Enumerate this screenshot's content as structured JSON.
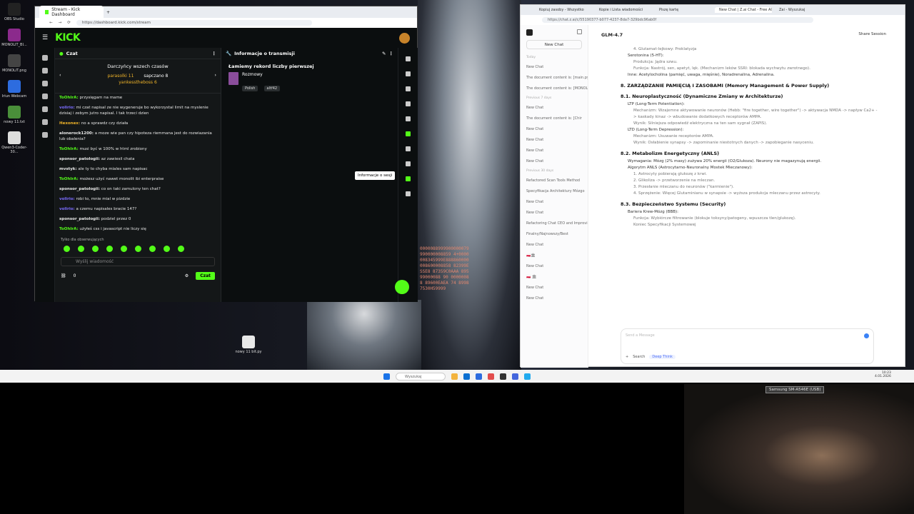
{
  "desktop": {
    "icons": [
      {
        "label": "OBS Studio",
        "icon": "obs-icon",
        "color": "#222222"
      },
      {
        "label": "MONOLIT_BI...",
        "icon": "winrar-icon",
        "color": "#8b2a8c"
      },
      {
        "label": "MONOLIT.png",
        "icon": "image-icon",
        "color": "#444444"
      },
      {
        "label": "Iriun Webcam",
        "icon": "webcam-icon",
        "color": "#2d6cdf"
      },
      {
        "label": "nowy 11.txt",
        "icon": "text-file-icon",
        "color": "#4a8f3a"
      },
      {
        "label": "Qwen3-Coder-30...",
        "icon": "document-icon",
        "color": "#dddddd"
      }
    ],
    "file_icon_label": "nowy 11 bit.py"
  },
  "kick_browser": {
    "tab_title": "Stream - Kick Dashboard",
    "url": "https://dashboard.kick.com/stream",
    "logo": "KICK",
    "chat": {
      "title": "Czat",
      "gifters_title": "Darczyńcy wszech czasów",
      "gifters": [
        {
          "name": "parasolki",
          "count": "11"
        },
        {
          "name": "sapczano",
          "count": "8"
        },
        {
          "name": "yankesstheboss",
          "count": "6"
        }
      ],
      "messages": [
        {
          "user": "ToOhIrA:",
          "text": "przysięgam na mame",
          "color": "#53fc18"
        },
        {
          "user": "volirio:",
          "text": "mi czat napisal ze nie wygeneruje bo wykorzystal limit na myslenie dzisiaj i zebym jutro napisal. I tak trzeci dzien",
          "color": "#7b6cff"
        },
        {
          "user": "Hexonex:",
          "text": "no a sprawdz czy działa",
          "color": "#f0b429"
        },
        {
          "user": "alonerock1200:",
          "text": "a moze wie pan czy hipoteza riemmana jest do rozwiazania lub obalenia?",
          "color": "#e8e8e8"
        },
        {
          "user": "ToOhIrA:",
          "text": "musi być w 100% w html zrobiony",
          "color": "#53fc18"
        },
        {
          "user": "sponsor_patologii:",
          "text": "az zawiesil chata",
          "color": "#e8e8e8"
        },
        {
          "user": "mvstyk:",
          "text": "ale ty to chyba miales sam napisac",
          "color": "#e8e8e8"
        },
        {
          "user": "ToOhIrA:",
          "text": "możesz użyć nawet monolit ibi enterpraise",
          "color": "#53fc18"
        },
        {
          "user": "sponsor_patologii:",
          "text": "co on taki zamulony ten chat?",
          "color": "#e8e8e8"
        },
        {
          "user": "volirio:",
          "text": "robi to, mnie mial w pizdzie",
          "color": "#7b6cff"
        },
        {
          "user": "volirio:",
          "text": "a czemu napisales bracie 147?",
          "color": "#7b6cff"
        },
        {
          "user": "sponsor_patologii:",
          "text": "podziel przez 0",
          "color": "#e8e8e8"
        },
        {
          "user": "ToOhIrA:",
          "text": "użyłeś css i javascript nie liczy się",
          "color": "#53fc18"
        }
      ],
      "followers_only": "Tylko dla obserwujących",
      "input_placeholder": "Wyślij wiadomość",
      "viewer_count": "0",
      "send_label": "Czat"
    },
    "stream_info": {
      "header": "Informacje o transmisji",
      "title": "Łamiemy rekord liczby pierwszej",
      "category": "Rozmowy",
      "tags": [
        "Polish",
        "altf42"
      ],
      "tooltip": "Informacje o sesji"
    }
  },
  "matrix_text": "0000088999900000079990000008859 4+0000008345999E888860000008600008858 82399ESSE8 87359C0AAA 89599000088 90 00000088 89600EAEA 74 8998 7530H59999",
  "zai_browser": {
    "tabs": [
      "Kopiuj zasoby - Wszystko",
      "Kopie i Lista wiadomości",
      "Piszę kartę",
      "New Chat | Z.ai Chat - Free AI po",
      "Zai - Wyszukaj"
    ],
    "url": "https://chat.z.ai/c/55190377-b077-4237-8da7-329bdc96ab0f",
    "sidebar": {
      "new_chat": "New Chat",
      "groups": [
        "Today",
        "Previous 7 days",
        "Previous 30 days"
      ],
      "items": [
        "New Chat",
        "The document content is: [main.py:",
        "The document content is: [MONOLI",
        "New Chat",
        "The document content is: [Chir",
        "New Chat",
        "New Chat",
        "New Chat",
        "New Chat",
        "Refactored Scan Tools Method",
        "Specyfikacja Architektury Mózgo",
        "New Chat",
        "New Chat",
        "Refactoring Chat CEO and Improving",
        "Finalny/Najnowszy/Best",
        "New Chat",
        "🇵🇱🏛",
        "New Chat",
        "🇵🇱 🏛",
        "New Chat",
        "New Chat"
      ]
    },
    "main": {
      "model": "GLM-4.7",
      "share": "Share Session",
      "content": [
        {
          "type": "sub",
          "text": "4. Glutamat-lejkowy: Proklatyzja"
        },
        {
          "type": "li",
          "text": "Serotonina (5-HT):"
        },
        {
          "type": "sub",
          "text": "Produkcja: Jądra szwu."
        },
        {
          "type": "sub",
          "text": "Funkcja: Nastrój, sen, apetyt, lęk. (Mechanizm leków SSRI: blokada wychwytu zwrotnego)."
        },
        {
          "type": "li",
          "text": "Inne: Acetylocholina (pamięć, uwaga, mięśnie), Noradrenalina, Adrenalina."
        },
        {
          "type": "h",
          "text": "8. ZARZĄDZANIE PAMIĘCIĄ I ZASOBAMI (Memory Management & Power Supply)"
        },
        {
          "type": "h",
          "text": "8.1. Neuroplastyczność (Dynamiczne Zmiany w Architekturze)"
        },
        {
          "type": "li",
          "text": "LTP (Long-Term Potentiation):"
        },
        {
          "type": "sub",
          "text": "Mechanizm: Wzajemne aktywowanie neuronów (Hebb: \"fire together, wire together\") -> aktywacja NMDA -> napływ Ca2+ -> kaskady kinaz -> wbudowanie dodatkowych receptorów AMPA."
        },
        {
          "type": "sub",
          "text": "Wynik: Silniejsza odpowiedź elektryczna na ten sam sygnał (ZAPIS)."
        },
        {
          "type": "li",
          "text": "LTD (Long-Term Depression):"
        },
        {
          "type": "sub",
          "text": "Mechanizm: Usuwanie receptorów AMPA."
        },
        {
          "type": "sub",
          "text": "Wynik: Osłabienie synapsy -> zapominanie niestotnych danych -> zapobieganie nasyceniu."
        },
        {
          "type": "h",
          "text": "8.2. Metabolizm Energetyczny (ANLS)"
        },
        {
          "type": "li",
          "text": "Wymagania: Mózg (2% masy) zużywa 20% energii (O2/Glukoza). Neurony nie magazynują energii."
        },
        {
          "type": "li",
          "text": "Algorytm ANLS (Astrocytarno-Neuronalny Mostek Mleczanowy):"
        },
        {
          "type": "sub",
          "text": "1. Astrocyty pobierają glukozę z krwi."
        },
        {
          "type": "sub",
          "text": "2. Glikoliza -> przetworzenie na mleczan."
        },
        {
          "type": "sub",
          "text": "3. Przesłanie mleczanu do neuronów (\"karmienie\")."
        },
        {
          "type": "sub",
          "text": "4. Sprzężenie: Więcej Glutaminianu w synapsie -> wyższa produkcja mleczanu przez astrocyty."
        },
        {
          "type": "h",
          "text": "8.3. Bezpieczeństwo Systemu (Security)"
        },
        {
          "type": "li",
          "text": "Bariera Krew-Mózg (BBB):"
        },
        {
          "type": "sub",
          "text": "Funkcja: Wybiórcze filtrowanie (blokuje toksyny/patogeny, wpuszcza tlen/glukozę)."
        },
        {
          "type": "sub",
          "text": "Koniec Specyfikacji Systemowej"
        }
      ],
      "input_placeholder": "Send a Message",
      "search_label": "Search",
      "deep_think_label": "Deep Think"
    }
  },
  "taskbar": {
    "search_placeholder": "Wyszukaj",
    "time": "10:23",
    "date": "4.01.2026"
  },
  "webcam": {
    "label": "Samsung SM-A546E (USB)"
  }
}
